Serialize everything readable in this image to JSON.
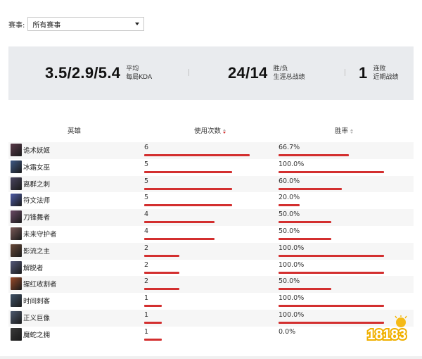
{
  "filter": {
    "label": "赛事:",
    "selected": "所有赛事"
  },
  "summary": {
    "kda": {
      "value": "3.5/2.9/5.4",
      "line1": "平均",
      "line2": "每局KDA"
    },
    "record": {
      "value": "24/14",
      "line1": "胜/负",
      "line2": "生涯总战绩"
    },
    "streak": {
      "value": "1",
      "line1": "连败",
      "line2": "近期战绩"
    }
  },
  "table": {
    "headers": {
      "hero": "英雄",
      "uses": "使用次数",
      "winrate": "胜率"
    },
    "sort_column": "uses",
    "rows": [
      {
        "hero": "诡术妖姬",
        "uses": "6",
        "winrate": "66.7%",
        "color": "#5a3a4a"
      },
      {
        "hero": "冰霜女巫",
        "uses": "5",
        "winrate": "100.0%",
        "color": "#3f5a86"
      },
      {
        "hero": "离群之刺",
        "uses": "5",
        "winrate": "60.0%",
        "color": "#4a4660"
      },
      {
        "hero": "符文法师",
        "uses": "5",
        "winrate": "20.0%",
        "color": "#4d5ca8"
      },
      {
        "hero": "刀锋舞者",
        "uses": "4",
        "winrate": "50.0%",
        "color": "#6b4a66"
      },
      {
        "hero": "未来守护者",
        "uses": "4",
        "winrate": "50.0%",
        "color": "#7a5a58"
      },
      {
        "hero": "影流之主",
        "uses": "2",
        "winrate": "100.0%",
        "color": "#6a4a3a"
      },
      {
        "hero": "解脱者",
        "uses": "2",
        "winrate": "100.0%",
        "color": "#55597a"
      },
      {
        "hero": "猩红收割者",
        "uses": "2",
        "winrate": "50.0%",
        "color": "#9a4a2a"
      },
      {
        "hero": "时间刺客",
        "uses": "1",
        "winrate": "100.0%",
        "color": "#3e5268"
      },
      {
        "hero": "正义巨像",
        "uses": "1",
        "winrate": "100.0%",
        "color": "#4d5a70"
      },
      {
        "hero": "魔蛇之拥",
        "uses": "1",
        "winrate": "0.0%",
        "color": "#3a3a3a"
      }
    ]
  },
  "watermark": {
    "text": "18183"
  },
  "colors": {
    "bar": "#d32f2f",
    "summary_bg": "#e9ebee"
  }
}
